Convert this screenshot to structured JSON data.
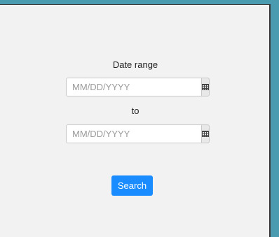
{
  "form": {
    "date_range_label": "Date range",
    "start_date": {
      "value": "",
      "placeholder": "MM/DD/YYYY"
    },
    "to_label": "to",
    "end_date": {
      "value": "",
      "placeholder": "MM/DD/YYYY"
    },
    "search_label": "Search",
    "calendar_icon": "calendar-icon"
  },
  "colors": {
    "background_frame": "#4a9bb0",
    "panel": "#f2f2f2",
    "accent": "#1a8cff"
  }
}
